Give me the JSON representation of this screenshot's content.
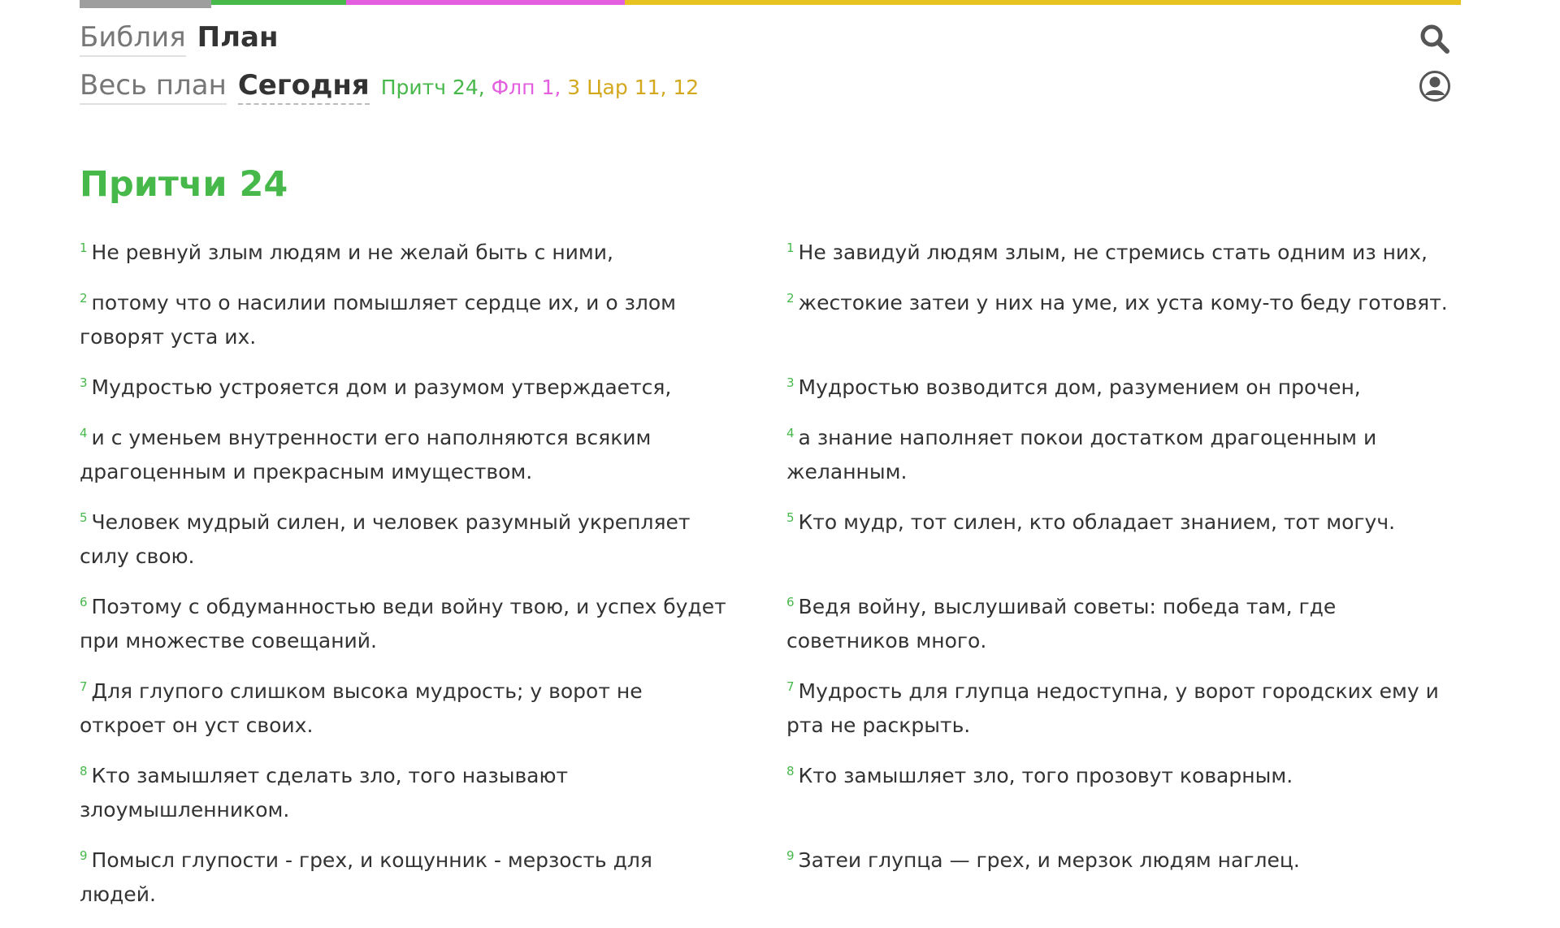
{
  "colors": {
    "accent_green": "#47b84a",
    "accent_pink": "#e45fe0",
    "accent_yellow": "#d4a81c",
    "text": "#333333",
    "muted": "#777777"
  },
  "progress": {
    "segments": [
      "done",
      "green",
      "pink",
      "yellow"
    ]
  },
  "header": {
    "bible_link": "Библия",
    "plan_current": "План",
    "whole_plan_link": "Весь план",
    "today_current": "Сегодня",
    "readings": [
      {
        "label": "Притч 24,",
        "color": "#47b84a"
      },
      {
        "label": "Флп 1,",
        "color": "#e45fe0"
      },
      {
        "label": "3 Цар 11, 12",
        "color": "#d4a81c"
      }
    ],
    "search_icon": "search-icon",
    "account_icon": "user-circle-icon"
  },
  "chapter": {
    "title": "Притчи 24",
    "verses": [
      {
        "num": "1",
        "left": "Не ревнуй злым людям и не желай быть с ними,",
        "right": "Не завидуй людям злым, не стремись стать одним из них,"
      },
      {
        "num": "2",
        "left": "потому что о насилии помышляет сердце их, и о злом говорят уста их.",
        "right": "жестокие затеи у них на уме, их уста кому-то беду готовят."
      },
      {
        "num": "3",
        "left": "Мудростью устрояется дом и разумом утверждается,",
        "right": "Мудростью возводится дом, разумением он прочен,"
      },
      {
        "num": "4",
        "left": "и с уменьем внутренности его наполняются всяким драгоценным и прекрасным имуществом.",
        "right": "а знание наполняет покои достатком драгоценным и желанным."
      },
      {
        "num": "5",
        "left": "Человек мудрый силен, и человек разумный укрепляет силу свою.",
        "right": "Кто мудр, тот силен, кто обладает знанием, тот могуч."
      },
      {
        "num": "6",
        "left": "Поэтому с обдуманностью веди войну твою, и успех будет при множестве совещаний.",
        "right": "Ведя войну, выслушивай советы: победа там, где советников много."
      },
      {
        "num": "7",
        "left": "Для глупого слишком высока мудрость; у ворот не откроет он уст своих.",
        "right": "Мудрость для глупца недоступна, у ворот городских ему и рта не раскрыть."
      },
      {
        "num": "8",
        "left": "Кто замышляет сделать зло, того называют злоумышленником.",
        "right": "Кто замышляет зло, того прозовут коварным."
      },
      {
        "num": "9",
        "left": "Помысл глупости - грех, и кощунник - мерзость для людей.",
        "right": "Затеи глупца — грех, и мерзок людям наглец."
      }
    ]
  }
}
